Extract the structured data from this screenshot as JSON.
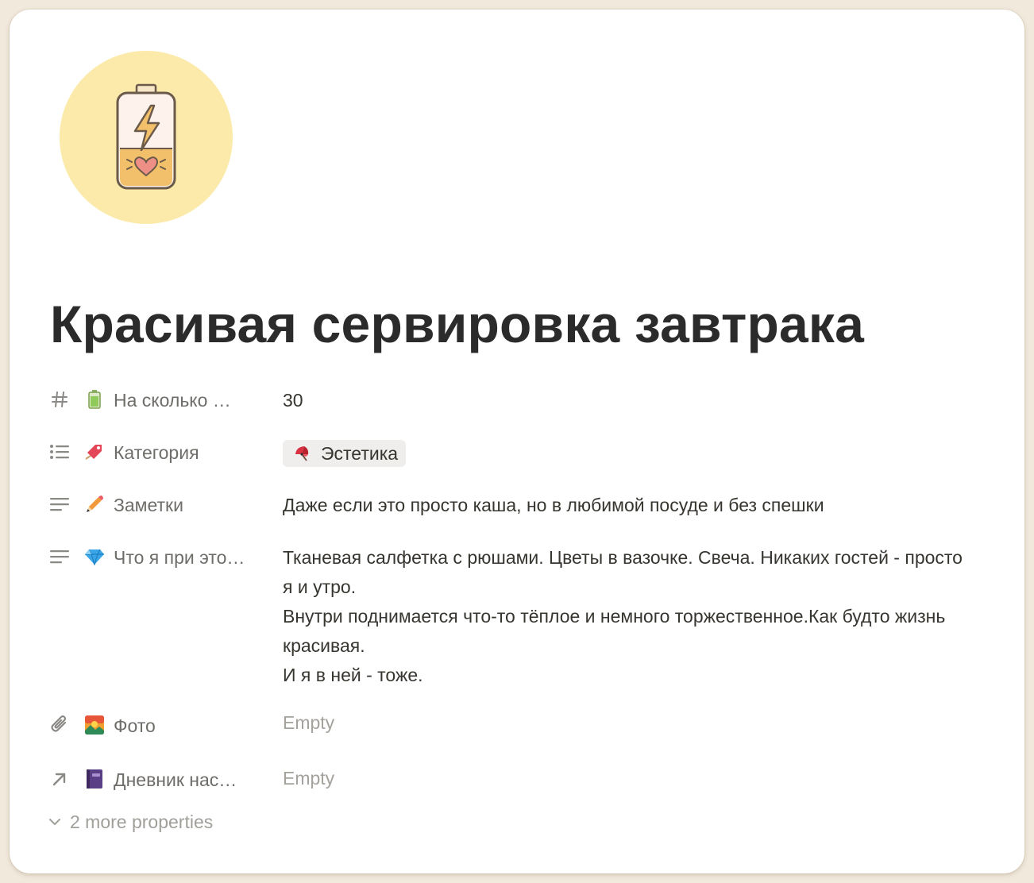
{
  "page": {
    "icon": "battery-heart-icon",
    "title": "Красивая сервировка завтрака"
  },
  "properties": [
    {
      "type_icon": "hash-icon",
      "emoji": "battery-icon",
      "label": "На сколько …",
      "value": "30"
    },
    {
      "type_icon": "list-icon",
      "emoji": "bookmark-icon",
      "label": "Категория",
      "tag": {
        "emoji": "fan-icon",
        "text": "Эстетика"
      }
    },
    {
      "type_icon": "text-icon",
      "emoji": "pencil-icon",
      "label": "Заметки",
      "value": "Даже если это просто каша, но в любимой посуде и без спешки"
    },
    {
      "type_icon": "text-icon",
      "emoji": "gem-icon",
      "label": "Что я при это…",
      "lines": [
        "Тканевая салфетка с рюшами. Цветы в вазочке. Свеча. Никаких гостей - просто",
        "я и утро.",
        "Внутри поднимается что-то тёплое и немного торжественное.Как будто жизнь",
        "красивая.",
        "И я в ней - тоже."
      ]
    },
    {
      "type_icon": "paperclip-icon",
      "emoji": "photo-icon",
      "label": "Фото",
      "value": "Empty"
    },
    {
      "type_icon": "arrow-up-right-icon",
      "emoji": "notebook-icon",
      "label": "Дневник нас…",
      "value": "Empty"
    }
  ],
  "more_properties": "2 more properties",
  "colors": {
    "background": "#f1e9dc",
    "card": "#ffffff",
    "title": "#2b2b2b",
    "label": "#6f6d69",
    "empty": "#a5a29d",
    "tag_bg": "#efeeec",
    "icon_circle": "#fbeaa9"
  }
}
